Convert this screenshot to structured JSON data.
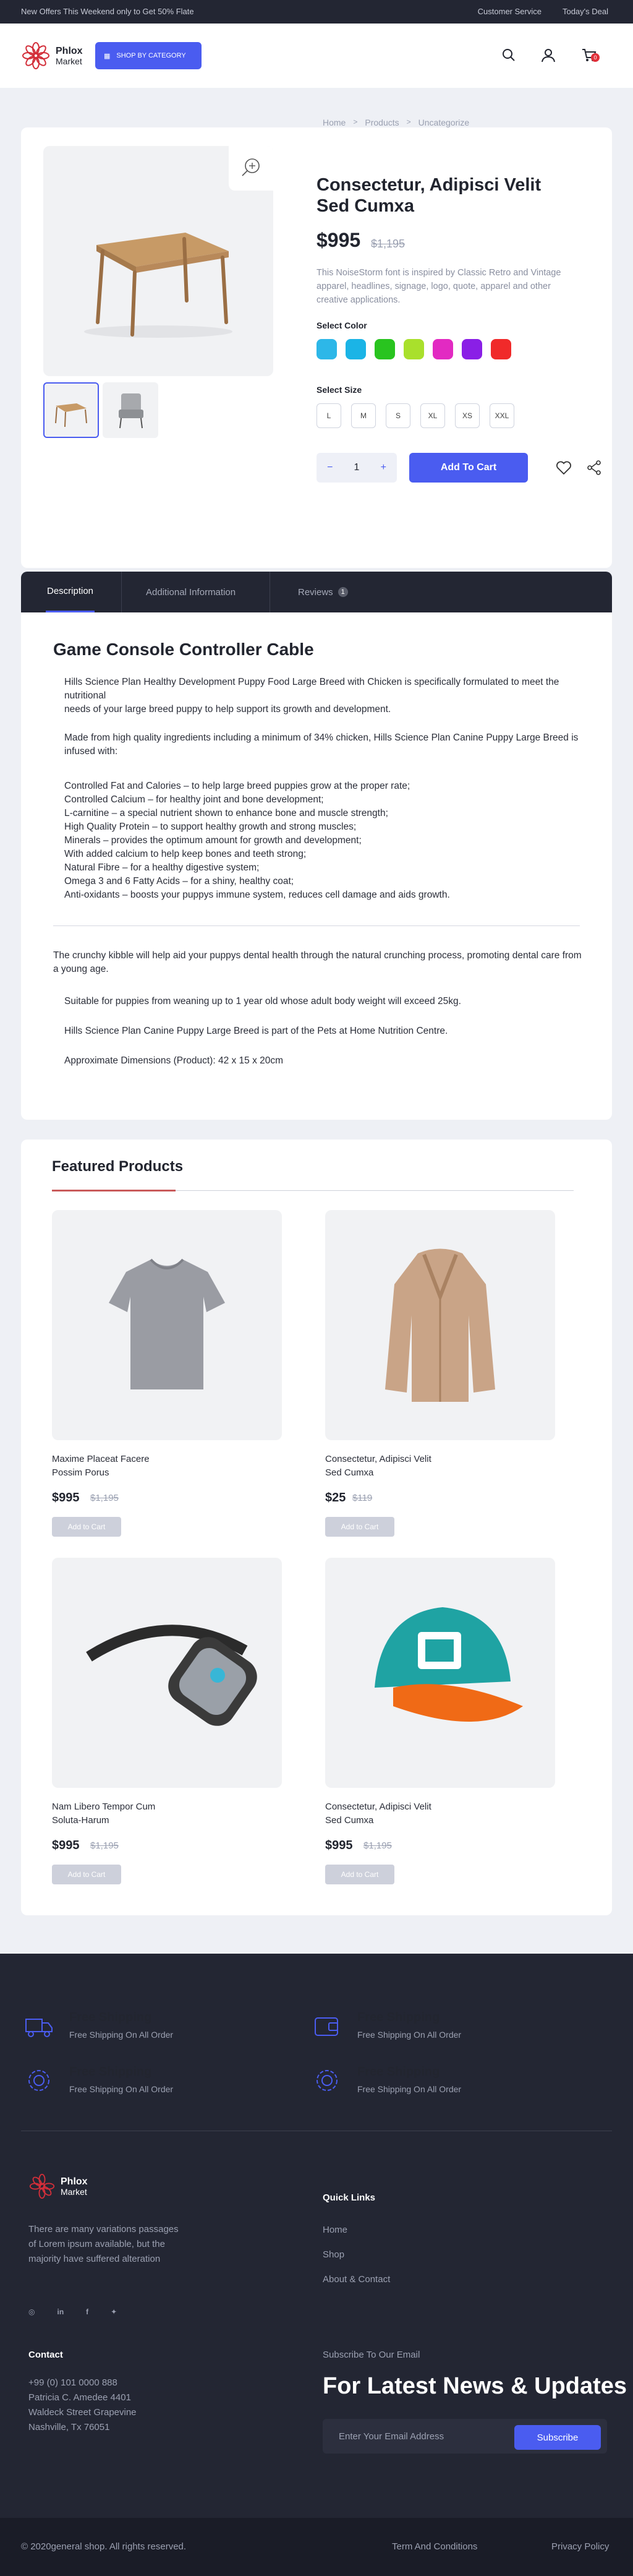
{
  "topbar": {
    "offer": "New Offers This Weekend only to Get 50% Flate",
    "customer_service": "Customer Service",
    "todays_deal": "Today's Deal"
  },
  "brand": {
    "name": "Phlox",
    "sub": "Market"
  },
  "header": {
    "category_label": "Shop by category",
    "cart_count": "0"
  },
  "breadcrumb": [
    "Home",
    "Products",
    "Uncategorize"
  ],
  "product": {
    "title": "Consectetur, Adipisci Velit Sed Cumxa",
    "price": "$995",
    "old_price": "$1,195",
    "description": "This NoiseStorm font is inspired by Classic Retro and Vintage apparel, headlines, signage, logo, quote, apparel and other creative applications.",
    "select_color_label": "Select Color",
    "colors": [
      "#2db7e8",
      "#1bb4e6",
      "#29c41f",
      "#a9e02c",
      "#e22ac2",
      "#8a1fe6",
      "#f02a2a"
    ],
    "select_size_label": "Select Size",
    "sizes": [
      "L",
      "M",
      "S",
      "XL",
      "XS",
      "XXL"
    ],
    "qty": "1",
    "add_to_cart": "Add To Cart"
  },
  "tabs": {
    "description": "Description",
    "additional": "Additional Information",
    "reviews": "Reviews",
    "reviews_count": "1"
  },
  "description": {
    "title": "Game Console Controller Cable",
    "p1": "Hills Science Plan Healthy Development Puppy Food Large Breed with Chicken is specifically formulated to meet the nutritional",
    "p1b": "needs of your large breed puppy to help support its growth and development.",
    "p2": "Made from high quality ingredients including a minimum of 34% chicken, Hills Science Plan Canine Puppy Large Breed is infused with:",
    "list": [
      "Controlled Fat and Calories – to help large breed puppies grow at the proper rate;",
      "Controlled Calcium – for healthy joint and bone development;",
      "L-carnitine – a special nutrient shown to enhance bone and muscle strength;",
      "High Quality Protein – to support healthy growth and strong muscles;",
      "Minerals – provides the optimum amount for growth and development;",
      "With added calcium to help keep bones and teeth strong;",
      "Natural Fibre – for a healthy digestive system;",
      "Omega 3 and 6 Fatty Acids – for a shiny, healthy coat;",
      "Anti-oxidants – boosts your puppys immune system, reduces cell damage and aids growth."
    ],
    "p3": "The crunchy kibble will help aid your puppys dental health through the natural crunching process, promoting dental care from a young age.",
    "p4": "Suitable for puppies from weaning up to 1 year old whose adult body weight will exceed 25kg.",
    "p5": "Hills Science Plan Canine Puppy Large Breed is part of the Pets at Home Nutrition Centre.",
    "p6": "Approximate Dimensions (Product): 42 x 15 x 20cm"
  },
  "featured": {
    "title": "Featured Products",
    "add_label": "Add to Cart",
    "items": [
      {
        "name1": "Maxime Placeat Facere",
        "name2": "Possim Porus",
        "price": "$995",
        "old": "$1,195",
        "icon": "tshirt-icon"
      },
      {
        "name1": "Consectetur, Adipisci Velit",
        "name2": "Sed Cumxa",
        "price": "$25",
        "old": "$119",
        "icon": "fur-coat-icon"
      },
      {
        "name1": "Nam Libero Tempor Cum",
        "name2": "Soluta-Harum",
        "price": "$995",
        "old": "$1,195",
        "icon": "vr-headset-icon"
      },
      {
        "name1": "Consectetur, Adipisci Velit",
        "name2": "Sed Cumxa",
        "price": "$995",
        "old": "$1,195",
        "icon": "cap-icon"
      }
    ]
  },
  "footer": {
    "shipping": [
      {
        "title": "Free Shipping",
        "sub": "Free Shipping On All Order"
      },
      {
        "title": "Free Shipping",
        "sub": "Free Shipping On All Order"
      },
      {
        "title": "Free Shipping",
        "sub": "Free Shipping On All Order"
      },
      {
        "title": "Free Shipping",
        "sub": "Free Shipping On All Order"
      }
    ],
    "about": "There are many variations passages of Lorem ipsum available, but the majority have suffered alteration",
    "quick_links_title": "Quick Links",
    "quick_links": [
      "Home",
      "Shop",
      "About & Contact"
    ],
    "contact_title": "Contact",
    "contact": [
      "+99 (0) 101 0000 888",
      "Patricia C. Amedee 4401",
      "Waldeck Street Grapevine",
      "Nashville, Tx 76051"
    ],
    "subscribe_title": "Subscribe To Our Email",
    "news_title": "For Latest News & Updates",
    "email_placeholder": "Enter Your Email Address",
    "subscribe_btn": "Subscribe",
    "copyright": "© 2020general shop. All rights reserved.",
    "terms": "Term And Conditions",
    "privacy": "Privacy Policy"
  }
}
